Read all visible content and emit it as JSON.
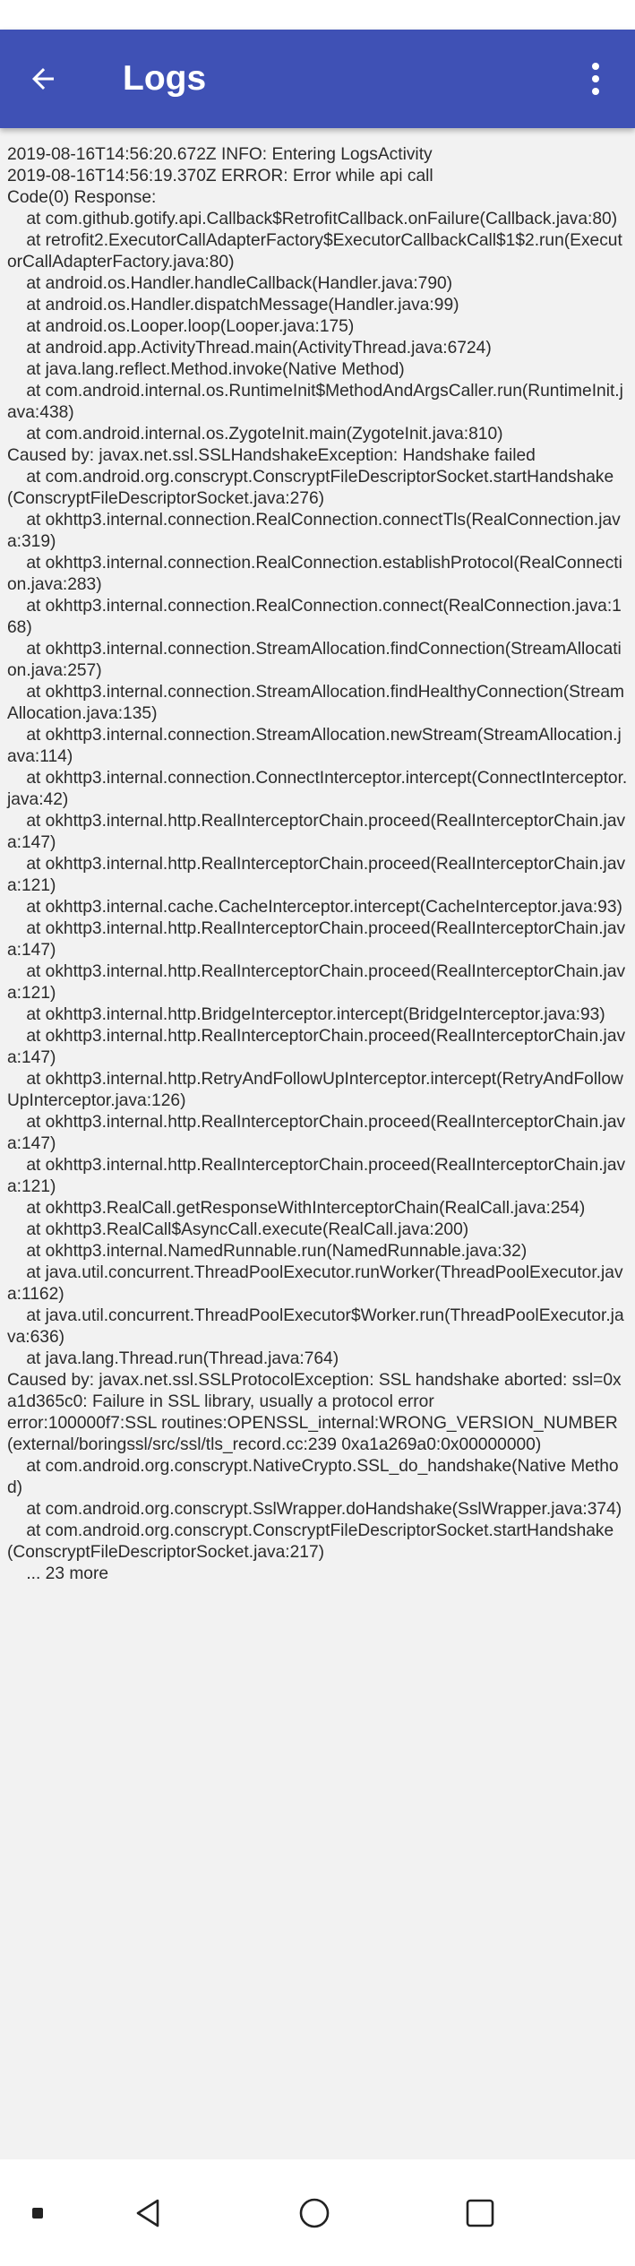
{
  "app_bar": {
    "title": "Logs",
    "background_color": "#3f51b5",
    "title_color": "#ffffff",
    "back_icon": "arrow-back-icon",
    "overflow_icon": "more-vert-icon"
  },
  "log": {
    "lines": [
      "2019-08-16T14:56:20.672Z INFO: Entering LogsActivity",
      "2019-08-16T14:56:19.370Z ERROR: Error while api call",
      "Code(0) Response:",
      "    at com.github.gotify.api.Callback$RetrofitCallback.onFailure(Callback.java:80)",
      "    at retrofit2.ExecutorCallAdapterFactory$ExecutorCallbackCall$1$2.run(ExecutorCallAdapterFactory.java:80)",
      "    at android.os.Handler.handleCallback(Handler.java:790)",
      "    at android.os.Handler.dispatchMessage(Handler.java:99)",
      "    at android.os.Looper.loop(Looper.java:175)",
      "    at android.app.ActivityThread.main(ActivityThread.java:6724)",
      "    at java.lang.reflect.Method.invoke(Native Method)",
      "    at com.android.internal.os.RuntimeInit$MethodAndArgsCaller.run(RuntimeInit.java:438)",
      "    at com.android.internal.os.ZygoteInit.main(ZygoteInit.java:810)",
      "Caused by: javax.net.ssl.SSLHandshakeException: Handshake failed",
      "    at com.android.org.conscrypt.ConscryptFileDescriptorSocket.startHandshake(ConscryptFileDescriptorSocket.java:276)",
      "    at okhttp3.internal.connection.RealConnection.connectTls(RealConnection.java:319)",
      "    at okhttp3.internal.connection.RealConnection.establishProtocol(RealConnection.java:283)",
      "    at okhttp3.internal.connection.RealConnection.connect(RealConnection.java:168)",
      "    at okhttp3.internal.connection.StreamAllocation.findConnection(StreamAllocation.java:257)",
      "    at okhttp3.internal.connection.StreamAllocation.findHealthyConnection(StreamAllocation.java:135)",
      "    at okhttp3.internal.connection.StreamAllocation.newStream(StreamAllocation.java:114)",
      "    at okhttp3.internal.connection.ConnectInterceptor.intercept(ConnectInterceptor.java:42)",
      "    at okhttp3.internal.http.RealInterceptorChain.proceed(RealInterceptorChain.java:147)",
      "    at okhttp3.internal.http.RealInterceptorChain.proceed(RealInterceptorChain.java:121)",
      "    at okhttp3.internal.cache.CacheInterceptor.intercept(CacheInterceptor.java:93)",
      "    at okhttp3.internal.http.RealInterceptorChain.proceed(RealInterceptorChain.java:147)",
      "    at okhttp3.internal.http.RealInterceptorChain.proceed(RealInterceptorChain.java:121)",
      "    at okhttp3.internal.http.BridgeInterceptor.intercept(BridgeInterceptor.java:93)",
      "    at okhttp3.internal.http.RealInterceptorChain.proceed(RealInterceptorChain.java:147)",
      "    at okhttp3.internal.http.RetryAndFollowUpInterceptor.intercept(RetryAndFollowUpInterceptor.java:126)",
      "    at okhttp3.internal.http.RealInterceptorChain.proceed(RealInterceptorChain.java:147)",
      "    at okhttp3.internal.http.RealInterceptorChain.proceed(RealInterceptorChain.java:121)",
      "    at okhttp3.RealCall.getResponseWithInterceptorChain(RealCall.java:254)",
      "    at okhttp3.RealCall$AsyncCall.execute(RealCall.java:200)",
      "    at okhttp3.internal.NamedRunnable.run(NamedRunnable.java:32)",
      "    at java.util.concurrent.ThreadPoolExecutor.runWorker(ThreadPoolExecutor.java:1162)",
      "    at java.util.concurrent.ThreadPoolExecutor$Worker.run(ThreadPoolExecutor.java:636)",
      "    at java.lang.Thread.run(Thread.java:764)",
      "Caused by: javax.net.ssl.SSLProtocolException: SSL handshake aborted: ssl=0xa1d365c0: Failure in SSL library, usually a protocol error",
      "error:100000f7:SSL routines:OPENSSL_internal:WRONG_VERSION_NUMBER (external/boringssl/src/ssl/tls_record.cc:239 0xa1a269a0:0x00000000)",
      "    at com.android.org.conscrypt.NativeCrypto.SSL_do_handshake(Native Method)",
      "    at com.android.org.conscrypt.SslWrapper.doHandshake(SslWrapper.java:374)",
      "    at com.android.org.conscrypt.ConscryptFileDescriptorSocket.startHandshake(ConscryptFileDescriptorSocket.java:217)",
      "    ... 23 more"
    ]
  },
  "nav_bar": {
    "menu_icon": "menu-square-icon",
    "back_icon": "nav-back-icon",
    "home_icon": "nav-home-icon",
    "recents_icon": "nav-recents-icon"
  }
}
